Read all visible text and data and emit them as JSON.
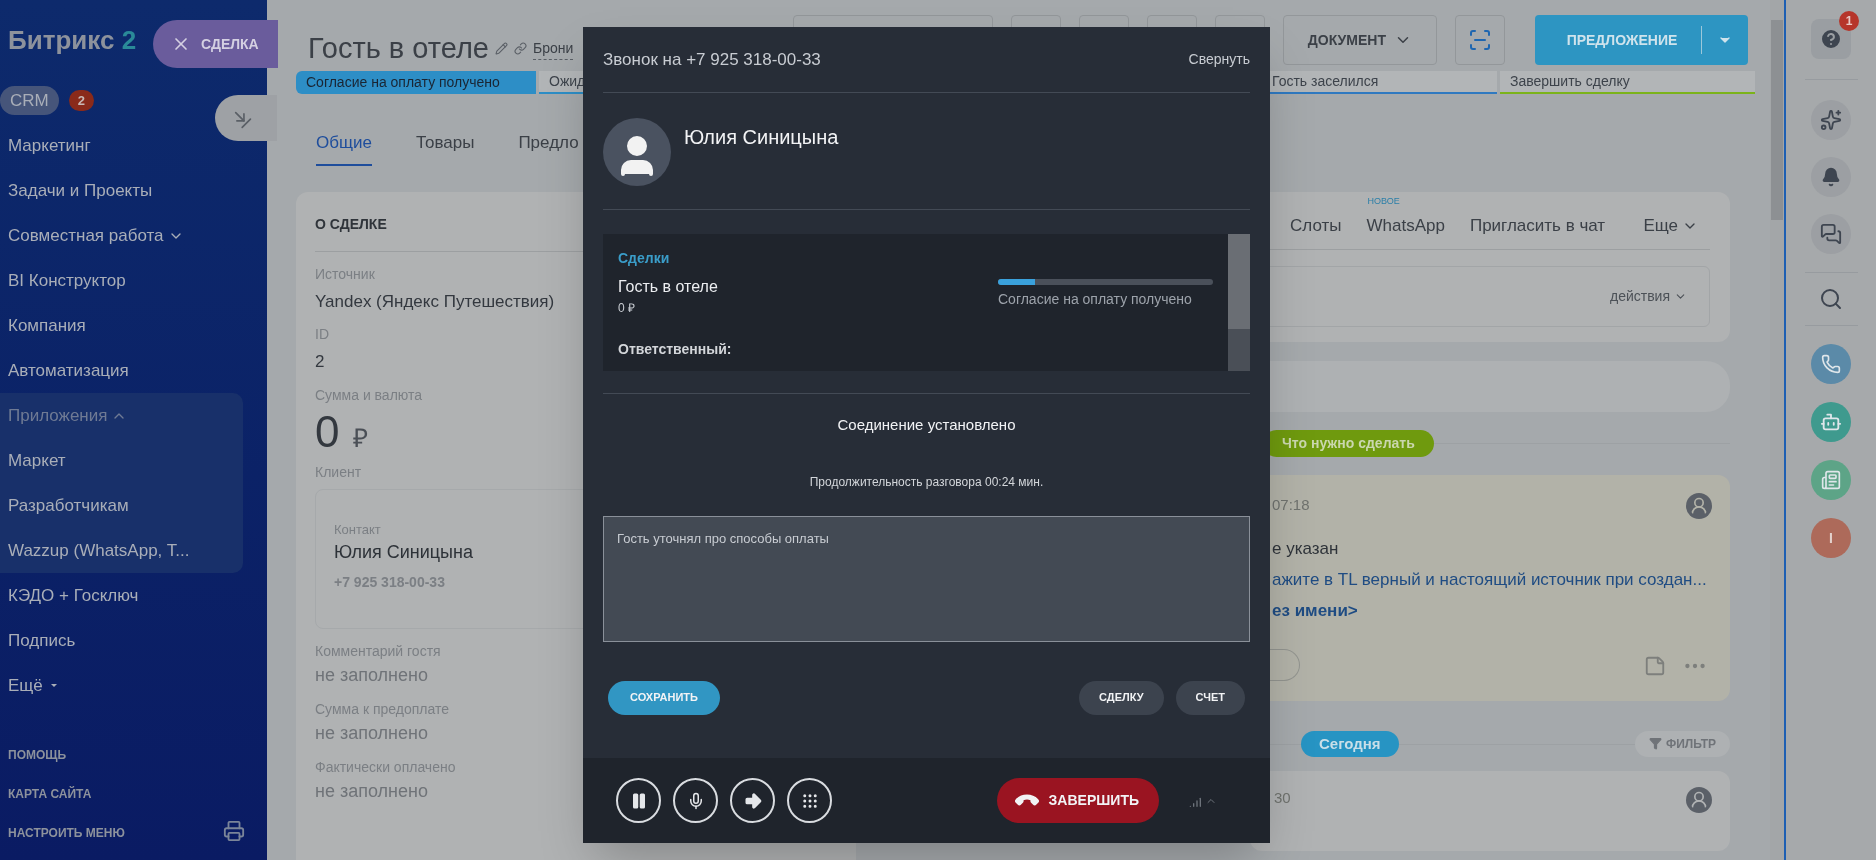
{
  "sidebar": {
    "logo": {
      "name": "Битрикс",
      "suffix": "2"
    },
    "items": [
      {
        "label": "CRM",
        "kind": "link",
        "selected": true,
        "badge": "2"
      },
      {
        "label": "Маркетинг",
        "kind": "link",
        "selected": false
      },
      {
        "label": "Задачи и Проекты",
        "kind": "link",
        "selected": false
      },
      {
        "label": "Совместная работа",
        "kind": "group",
        "selected": false,
        "expanded": false
      },
      {
        "label": "BI Конструктор",
        "kind": "link",
        "selected": false
      },
      {
        "label": "Компания",
        "kind": "link",
        "selected": false
      },
      {
        "label": "Автоматизация",
        "kind": "link",
        "selected": false
      },
      {
        "label": "Приложения",
        "kind": "group",
        "selected": false,
        "expanded": true,
        "children": [
          {
            "label": "Маркет"
          },
          {
            "label": "Разработчикам"
          },
          {
            "label": "Wazzup (WhatsApp, T..."
          }
        ]
      },
      {
        "label": "КЭДО + Госключ",
        "kind": "link",
        "selected": false
      },
      {
        "label": "Подпись",
        "kind": "link",
        "selected": false
      },
      {
        "label": "Ещё",
        "kind": "more",
        "selected": false
      }
    ],
    "footer_links": [
      "ПОМОЩЬ",
      "КАРТА САЙТА",
      "НАСТРОИТЬ МЕНЮ"
    ]
  },
  "close_tab": {
    "label": "СДЕЛКА"
  },
  "header": {
    "title": "Гость в отеле",
    "link": "Брони",
    "document_button": "ДОКУМЕНТ",
    "primary_button": "ПРЕДЛОЖЕНИЕ"
  },
  "stages": [
    {
      "label": "Согласие на оплату получено",
      "selected": true,
      "color": "#2d8ec6"
    },
    {
      "label": "Ожид",
      "selected": false,
      "color": "#2d8ec6"
    },
    {
      "label": "Гость заселился",
      "selected": false,
      "color": "#2f79c0"
    },
    {
      "label": "Завершить сделку",
      "selected": false,
      "color": "#7bb31a"
    }
  ],
  "tabs": [
    {
      "label": "Общие",
      "selected": true
    },
    {
      "label": "Товары",
      "selected": false
    },
    {
      "label": "Предло",
      "selected": false
    }
  ],
  "deal_card": {
    "title": "О СДЕЛКЕ",
    "fields": [
      {
        "kind": "text",
        "label": "Источник",
        "value": "Yandex (Яндекс Путешествия)"
      },
      {
        "kind": "text",
        "label": "ID",
        "value": "2"
      },
      {
        "kind": "amount",
        "label": "Сумма и валюта",
        "value": "0",
        "currency": "₽"
      },
      {
        "kind": "contact",
        "label": "Клиент",
        "contact_label": "Контакт",
        "name": "Юлия Синицына",
        "phone": "+7 925 318-00-33"
      },
      {
        "kind": "empty",
        "label": "Комментарий гостя",
        "value": "не заполнено"
      },
      {
        "kind": "empty",
        "label": "Сумма к предоплате",
        "value": "не заполнено"
      },
      {
        "kind": "empty",
        "label": "Фактически оплачено",
        "value": "не заполнено"
      }
    ]
  },
  "timeline": {
    "tabs": [
      {
        "label": "Слоты"
      },
      {
        "label": "WhatsApp",
        "badge": "НОВОЕ"
      },
      {
        "label": "Пригласить в чат"
      }
    ],
    "more": "Еще",
    "actions": "действия",
    "todo_badge": "Что нужно сделать",
    "activity": {
      "time": "07:18",
      "lines": [
        {
          "kind": "plain",
          "text": "е указан"
        },
        {
          "kind": "link",
          "text": "ажите в TL верный и настоящий источник при создан..."
        },
        {
          "kind": "bold_link",
          "text": "ез имени>"
        }
      ]
    },
    "today_badge": "Сегодня",
    "filter": "ФИЛЬТР",
    "next_time": "30"
  },
  "call": {
    "title": "Звонок на +7 925 318-00-33",
    "minimize": "Свернуть",
    "caller": "Юлия Синицына",
    "deals": {
      "heading": "Сделки",
      "items": [
        {
          "title": "Гость в отеле",
          "amount": "0 ₽",
          "stage": "Согласие на оплату получено",
          "level": 0.17
        }
      ],
      "responsible_label": "Ответственный:"
    },
    "status": "Соединение установлено",
    "duration": "Продолжительность разговора 00:24 мин.",
    "comment": "Гость уточнял про способы оплаты",
    "buttons": [
      {
        "label": "СОХРАНИТЬ",
        "kind": "primary"
      },
      {
        "label": "СДЕЛКУ",
        "kind": "secondary"
      },
      {
        "label": "СЧЕТ",
        "kind": "secondary"
      }
    ],
    "controls": [
      {
        "kind": "pause"
      },
      {
        "kind": "mute"
      },
      {
        "kind": "transfer"
      },
      {
        "kind": "keypad"
      }
    ],
    "hangup": "ЗАВЕРШИТЬ"
  },
  "rail": {
    "help_badge": "1",
    "user_initial": "I"
  }
}
